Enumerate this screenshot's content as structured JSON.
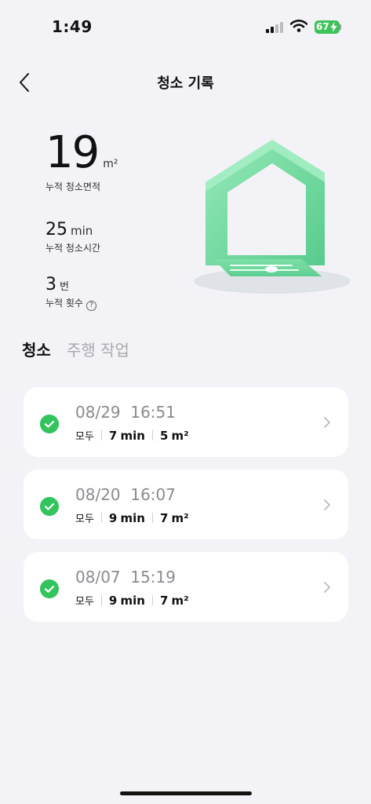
{
  "status_bar": {
    "time": "1:49",
    "battery": "67"
  },
  "header": {
    "title": "청소 기록"
  },
  "stats": {
    "area": {
      "value": "19",
      "unit": "m²",
      "label": "누적 청소면적"
    },
    "time": {
      "value": "25",
      "unit": "min",
      "label": "누적 청소시간"
    },
    "count": {
      "value": "3",
      "unit": "번",
      "label": "누적 횟수"
    }
  },
  "tabs": [
    {
      "label": "청소",
      "active": true
    },
    {
      "label": "주행 작업",
      "active": false
    }
  ],
  "records": [
    {
      "date": "08/29",
      "time": "16:51",
      "mode": "모두",
      "duration": "7",
      "duration_unit": "min",
      "area": "5",
      "area_unit": "m²"
    },
    {
      "date": "08/20",
      "time": "16:07",
      "mode": "모두",
      "duration": "9",
      "duration_unit": "min",
      "area": "7",
      "area_unit": "m²"
    },
    {
      "date": "08/07",
      "time": "15:19",
      "mode": "모두",
      "duration": "9",
      "duration_unit": "min",
      "area": "7",
      "area_unit": "m²"
    }
  ],
  "colors": {
    "accent_green": "#33c45e",
    "background": "#f2f2f7",
    "battery_green": "#3fc25a"
  }
}
